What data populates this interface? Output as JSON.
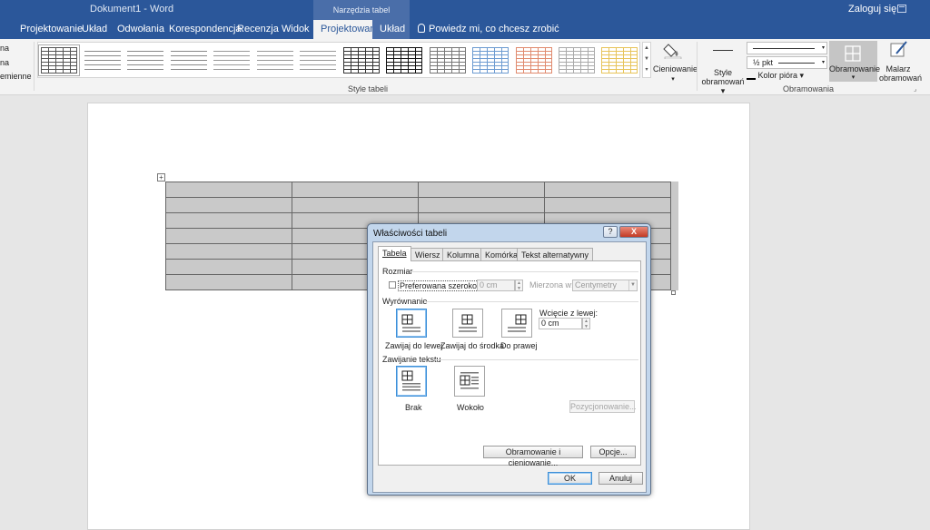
{
  "app": {
    "window_title": "Dokument1 - Word",
    "context_header": "Narzędzia tabel",
    "signin": "Zaloguj się"
  },
  "tabs": {
    "projektowanie": "Projektowanie",
    "uklad": "Układ",
    "odwolania": "Odwołania",
    "korespondencja": "Korespondencja",
    "recenzja": "Recenzja",
    "widok": "Widok",
    "ctx_projektowanie": "Projektowanie",
    "ctx_uklad": "Układ",
    "tell_me": "Powiedz mi, co chcesz zrobić"
  },
  "ribbon": {
    "left_opts": [
      "na",
      "na",
      "emienne"
    ],
    "styles_group_label": "Style tabeli",
    "shading_label": "Cieniowanie",
    "border_styles_label": "Style",
    "border_styles_label2": "obramowań",
    "pen_weight": "½ pkt",
    "pen_color_label": "Kolor pióra",
    "borders_label": "Obramowanie",
    "painter_label": "Malarz",
    "painter_label2": "obramowań",
    "borders_group_label": "Obramowania"
  },
  "dialog": {
    "title": "Właściwości tabeli",
    "help": "?",
    "close": "X",
    "tabs": {
      "tabela": "Tabela",
      "wiersz": "Wiersz",
      "kolumna": "Kolumna",
      "komorka": "Komórka",
      "tekst_alt": "Tekst alternatywny"
    },
    "size_section": "Rozmiar",
    "preferred_width_label": "Preferowana szerokość:",
    "preferred_width_value": "0 cm",
    "measure_in_label": "Mierzona w:",
    "measure_in_value": "Centymetry",
    "alignment_section": "Wyrównanie",
    "align_left": "Zawijaj do lewej",
    "align_center": "Zawijaj do środka",
    "align_right": "Do prawej",
    "indent_label": "Wcięcie z lewej:",
    "indent_value": "0 cm",
    "wrapping_section": "Zawijanie tekstu",
    "wrap_none": "Brak",
    "wrap_around": "Wokoło",
    "positioning_btn": "Pozycjonowanie...",
    "borders_shading_btn": "Obramowanie i cieniowanie...",
    "options_btn": "Opcje...",
    "ok": "OK",
    "cancel": "Anuluj"
  },
  "colors": {
    "accent": "#2b579a",
    "dialog_frame": "#c2d6ec",
    "selection_blue": "#3c8fd8"
  }
}
